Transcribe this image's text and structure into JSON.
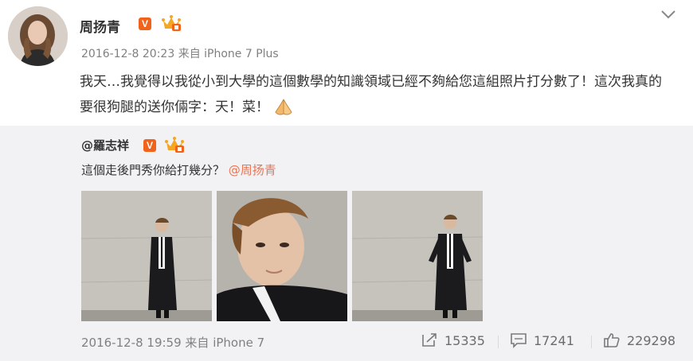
{
  "post": {
    "author": {
      "name": "周扬青",
      "verified_badge": "V",
      "crown_icon": "vip-crown-icon",
      "avatar_icon": "user-avatar"
    },
    "meta": {
      "date": "2016-12-8 20:23",
      "source_prefix": "来自",
      "source": "iPhone 7 Plus"
    },
    "text": "我天…我覺得以我從小到大學的這個數學的知識領域已經不夠給您這組照片打分數了！這次我真的要很狗腿的送你倆字：天！菜！",
    "emoji": "praying-hands-icon",
    "menu_icon": "chevron-down-icon"
  },
  "retweet": {
    "author": {
      "handle": "@羅志祥",
      "verified_badge": "V",
      "crown_icon": "vip-crown-icon"
    },
    "text": "這個走後門秀你給打幾分？",
    "mention": "@周扬青",
    "photos": [
      {
        "icon": "photo-full-length-portrait"
      },
      {
        "icon": "photo-closeup-portrait"
      },
      {
        "icon": "photo-full-length-portrait"
      }
    ],
    "meta": {
      "date": "2016-12-8 19:59",
      "source_prefix": "来自",
      "source": "iPhone 7"
    },
    "actions": {
      "repost": {
        "icon": "repost-icon",
        "count": "15335"
      },
      "comment": {
        "icon": "comment-icon",
        "count": "17241"
      },
      "like": {
        "icon": "thumbs-up-icon",
        "count": "229298"
      }
    }
  },
  "colors": {
    "background": "#ffffff",
    "retweet_background": "#f2f2f5",
    "mention": "#eb7350",
    "badge": "#f1631a",
    "meta_text": "#808080"
  }
}
